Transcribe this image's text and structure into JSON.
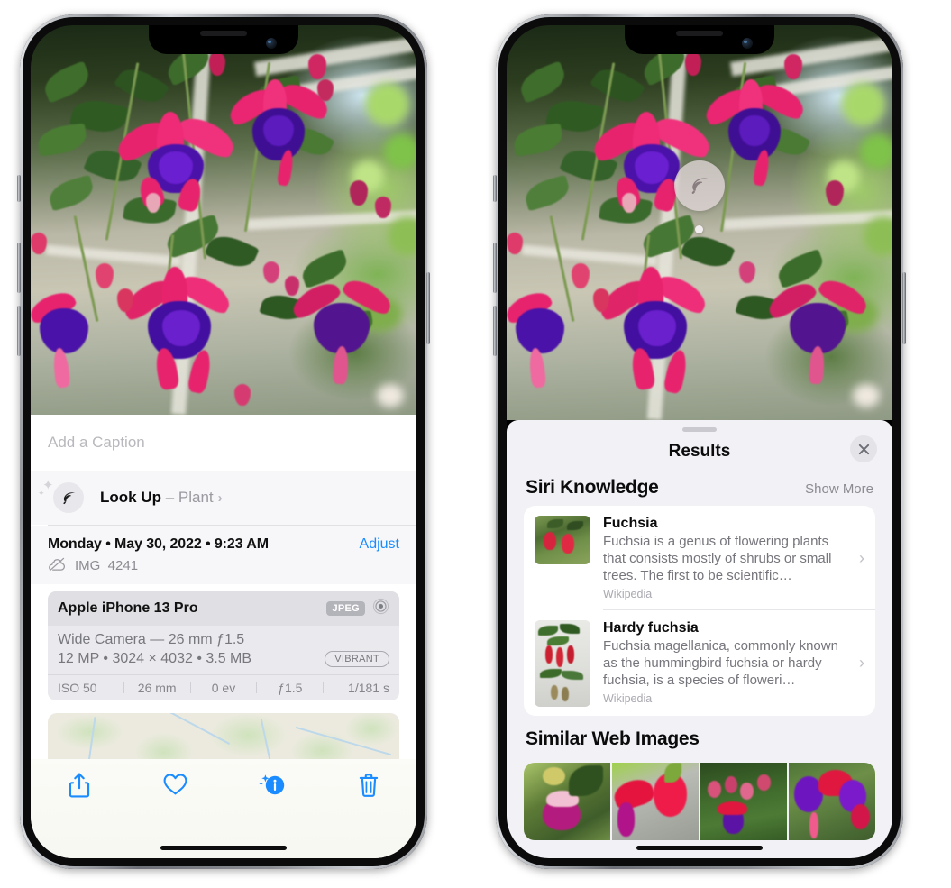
{
  "left_phone": {
    "name": "iPhone photo detail view",
    "photo_alt": "Fuchsia flowers hanging basket",
    "caption_placeholder": "Add a Caption",
    "lookup": {
      "label": "Look Up",
      "dash": " – ",
      "subject": "Plant",
      "chevron": "›",
      "icon": "leaf-icon"
    },
    "meta": {
      "date": "Monday • May 30, 2022 • 9:23 AM",
      "adjust_label": "Adjust",
      "filename": "IMG_4241",
      "cloud_icon": "cloud-slash-icon"
    },
    "exif": {
      "model": "Apple iPhone 13 Pro",
      "format_badge": "JPEG",
      "lens_icon": "aperture-icon",
      "line1": "Wide Camera — 26 mm ƒ1.5",
      "line2": "12 MP • 3024 × 4032 • 3.5 MB",
      "style_badge": "VIBRANT",
      "stats": [
        "ISO 50",
        "26 mm",
        "0 ev",
        "ƒ1.5",
        "1/181 s"
      ]
    },
    "toolbar": [
      {
        "name": "share-button",
        "icon": "share-icon"
      },
      {
        "name": "favorite-button",
        "icon": "heart-icon"
      },
      {
        "name": "info-button",
        "icon": "info-sparkle-icon"
      },
      {
        "name": "delete-button",
        "icon": "trash-icon"
      }
    ],
    "accent_color": "#1a8cff"
  },
  "right_phone": {
    "name": "Visual Look Up results view",
    "badge": {
      "icon": "leaf-icon",
      "name": "visual-lookup-badge"
    },
    "sheet": {
      "title": "Results",
      "close_icon": "close-icon",
      "sections": [
        {
          "title": "Siri Knowledge",
          "action": "Show More",
          "items": [
            {
              "title": "Fuchsia",
              "description": "Fuchsia is a genus of flowering plants that consists mostly of shrubs or small trees. The first to be scientific…",
              "source": "Wikipedia",
              "chevron": "›"
            },
            {
              "title": "Hardy fuchsia",
              "description": "Fuchsia magellanica, commonly known as the hummingbird fuchsia or hardy fuchsia, is a species of floweri…",
              "source": "Wikipedia",
              "chevron": "›"
            }
          ]
        },
        {
          "title": "Similar Web Images",
          "thumbs": [
            "fuchsia-web-image-1",
            "fuchsia-web-image-2",
            "fuchsia-web-image-3",
            "fuchsia-web-image-4"
          ]
        }
      ]
    },
    "panel_bg": "#f2f1f6"
  }
}
